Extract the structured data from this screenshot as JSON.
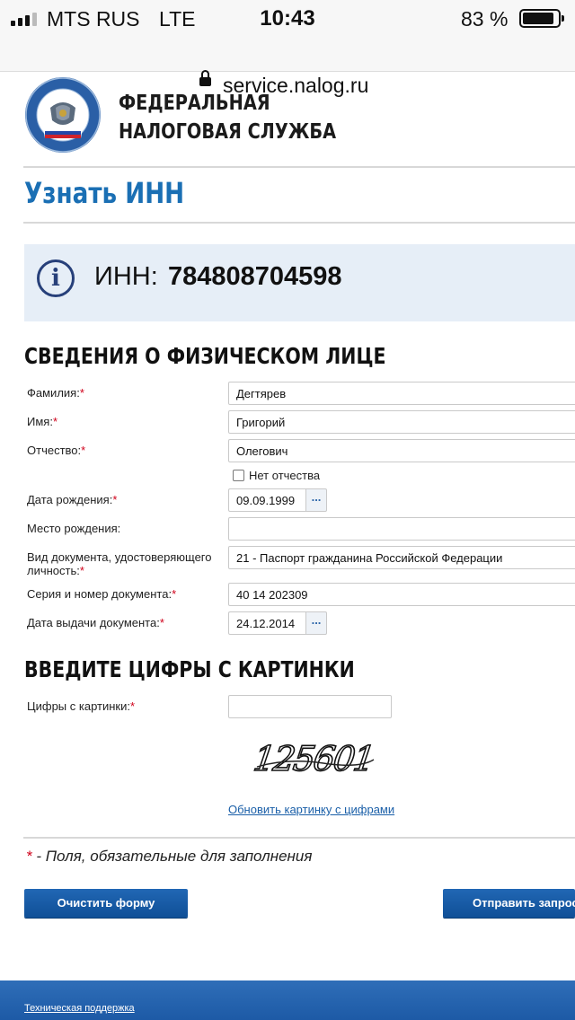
{
  "status_bar": {
    "carrier": "MTS RUS",
    "network": "LTE",
    "time": "10:43",
    "battery": "83 %"
  },
  "browser": {
    "url": "service.nalog.ru"
  },
  "header": {
    "org_line1": "ФЕДЕРАЛЬНАЯ",
    "org_line2": "НАЛОГОВАЯ СЛУЖБА",
    "logo_text": "ФЕДЕРАЛЬНАЯ НАЛОГОВАЯ СЛУЖБА"
  },
  "page": {
    "title": "Узнать ИНН"
  },
  "result": {
    "info_symbol": "i",
    "label": "ИНН:",
    "value": "784808704598"
  },
  "person_section": {
    "title": "СВЕДЕНИЯ О ФИЗИЧЕСКОМ ЛИЦЕ",
    "required_mark": "*",
    "fields": {
      "surname": {
        "label": "Фамилия:",
        "value": "Дегтярев"
      },
      "name": {
        "label": "Имя:",
        "value": "Григорий"
      },
      "patronymic": {
        "label": "Отчество:",
        "value": "Олегович"
      },
      "no_patronymic": {
        "label": "Нет отчества",
        "checked": false
      },
      "birth_date": {
        "label": "Дата рождения:",
        "value": "09.09.1999"
      },
      "birth_place": {
        "label": "Место рождения:",
        "value": ""
      },
      "doc_type": {
        "label_line1": "Вид документа, удостоверяющего",
        "label_line2": "личность:",
        "value": "21 - Паспорт гражданина Российской Федерации"
      },
      "doc_number": {
        "label": "Серия и номер документа:",
        "value": "40 14 202309"
      },
      "issue_date": {
        "label": "Дата выдачи документа:",
        "value": "24.12.2014"
      }
    },
    "calendar_button": "..."
  },
  "captcha_section": {
    "title": "ВВЕДИТЕ ЦИФРЫ С КАРТИНКИ",
    "field_label": "Цифры с картинки:",
    "field_value": "",
    "captcha_image_text": "125601",
    "refresh_link": "Обновить картинку с цифрами"
  },
  "footnote": {
    "mark": "*",
    "text": " - Поля, обязательные для заполнения"
  },
  "buttons": {
    "clear": "Очистить форму",
    "submit": "Отправить запрос"
  },
  "footer": {
    "support_link": "Техническая поддержка"
  },
  "colors": {
    "brand_blue": "#1a6fb4",
    "button_blue": "#1a5ea9",
    "info_box": "#e6eef7",
    "required_red": "#d0021b",
    "footer_blue": "#2f6eb8"
  }
}
